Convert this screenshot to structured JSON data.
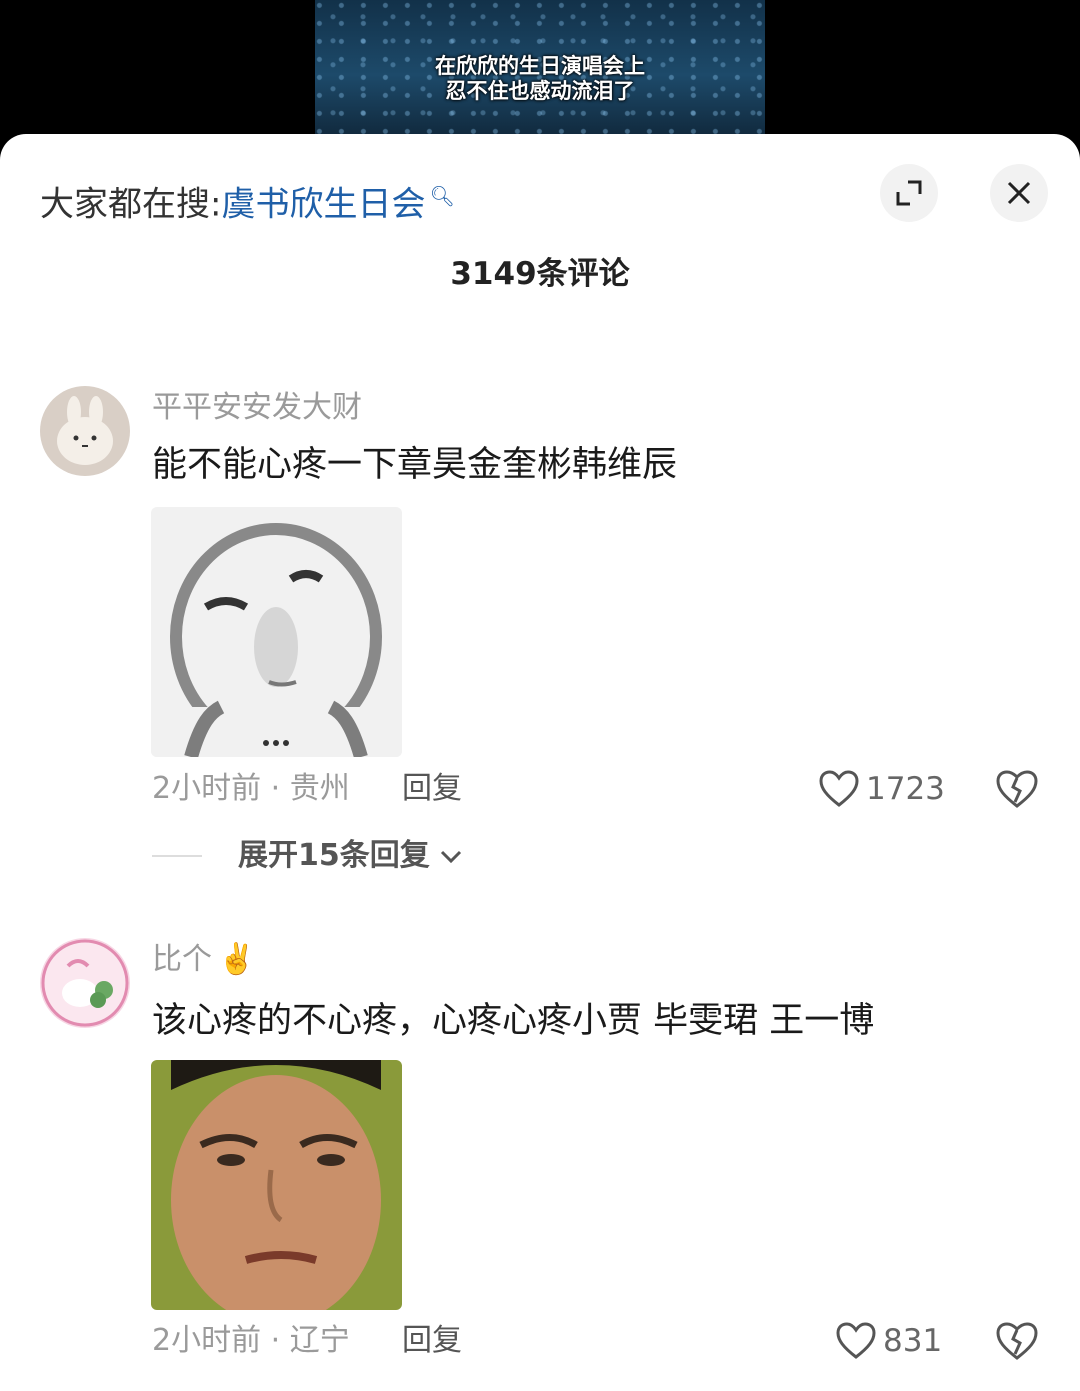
{
  "video": {
    "caption_line1": "在欣欣的生日演唱会上",
    "caption_line2": "忍不住也感动流泪了"
  },
  "header": {
    "search_prefix": "大家都在搜:",
    "search_term": "虞书欣生日会",
    "search_icon": "search-icon",
    "expand_icon": "expand-icon",
    "close_icon": "close-icon"
  },
  "comment_count": "3149条评论",
  "comments": [
    {
      "username": "平平安安发大财",
      "text": "能不能心疼一下章昊金奎彬韩维辰",
      "time_location": "2小时前 · 贵州",
      "reply_label": "回复",
      "likes": "1723",
      "expand_replies": "展开15条回复"
    },
    {
      "username": "比个",
      "username_emoji": "✌️",
      "text": "该心疼的不心疼，心疼心疼小贾 毕雯珺 王一博",
      "time_location": "2小时前 · 辽宁",
      "reply_label": "回复",
      "likes": "831"
    }
  ],
  "colors": {
    "search_term": "#1f5fa8",
    "meta_text": "#9a9a9a",
    "body_text": "#1a1a1a"
  }
}
